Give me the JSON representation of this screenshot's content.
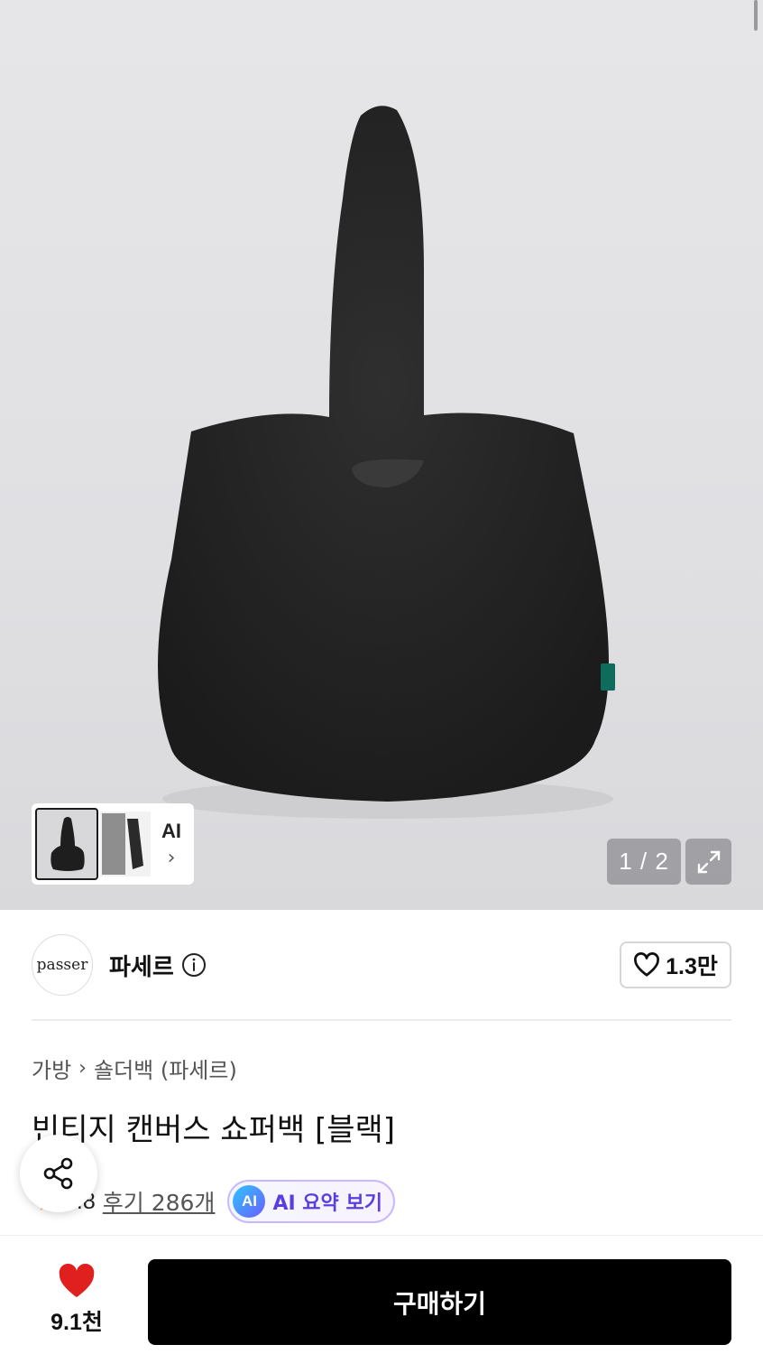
{
  "gallery": {
    "current": "1",
    "total": "2",
    "counter_label": "1 / 2",
    "ai_label": "AI",
    "chevron": "›"
  },
  "brand": {
    "logo_text": "passer",
    "name": "파세르",
    "like_count": "1.3만"
  },
  "product": {
    "breadcrumb": [
      "가방",
      "숄더백 (파세르)"
    ],
    "title": "빈티지 캔버스 쇼퍼백 [블랙]",
    "rating": "4.8",
    "reviews_label": "후기 286개",
    "ai_summary_badge": "AI",
    "ai_summary_label": "AI 요약 보기"
  },
  "bottom_bar": {
    "wishlist_count": "9.1천",
    "buy_label": "구매하기"
  },
  "colors": {
    "accent_heart": "#e0201f",
    "star": "#f5a623",
    "ai_purple": "#5a3ee0",
    "buy_button": "#000000"
  },
  "icons": [
    "info-icon",
    "heart-outline-icon",
    "heart-filled-icon",
    "expand-icon",
    "share-icon",
    "star-icon",
    "chevron-right-icon"
  ]
}
